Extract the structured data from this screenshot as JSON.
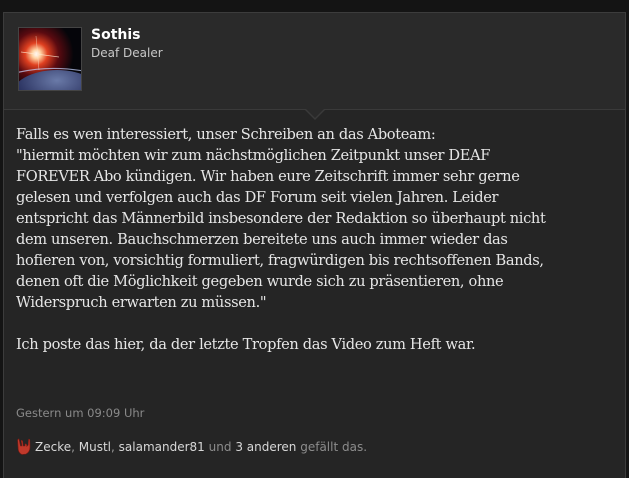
{
  "post": {
    "author": {
      "name": "Sothis",
      "title": "Deaf Dealer",
      "avatar_icon": "planet-avatar"
    },
    "message": {
      "lines_block1": "Falls es wen interessiert, unser Schreiben an das Aboteam:\n\"hiermit möchten wir zum nächstmöglichen Zeitpunkt unser DEAF\nFOREVER Abo kündigen. Wir haben eure Zeitschrift immer sehr gerne\ngelesen und verfolgen auch das DF Forum seit vielen Jahren. Leider\nentspricht das Männerbild insbesondere der Redaktion so überhaupt nicht\ndem unseren. Bauchschmerzen bereitete uns auch immer wieder das\nhofieren von, vorsichtig formuliert, fragwürdigen bis rechtsoffenen Bands,\ndenen oft die Möglichkeit gegeben wurde sich zu präsentieren, ohne\nWiderspruch erwarten zu müssen.\"",
      "lines_block2": "Ich poste das hier, da der letzte Tropfen das Video zum Heft war."
    },
    "timestamp": "Gestern um 09:09 Uhr",
    "likes": {
      "icon": "horns-icon",
      "user1": "Zecke",
      "sep1": ",",
      "user2": "Mustl",
      "sep2": ",",
      "user3": "salamander81",
      "and_text": "und",
      "others_link": "3 anderen",
      "suffix": "gefällt das."
    }
  },
  "colors": {
    "background": "#141414",
    "post_background": "#252525",
    "header_background": "#2a2a2a",
    "text": "#e6e6e6",
    "muted": "#8a8a8a",
    "like_icon": "#c0392b"
  }
}
